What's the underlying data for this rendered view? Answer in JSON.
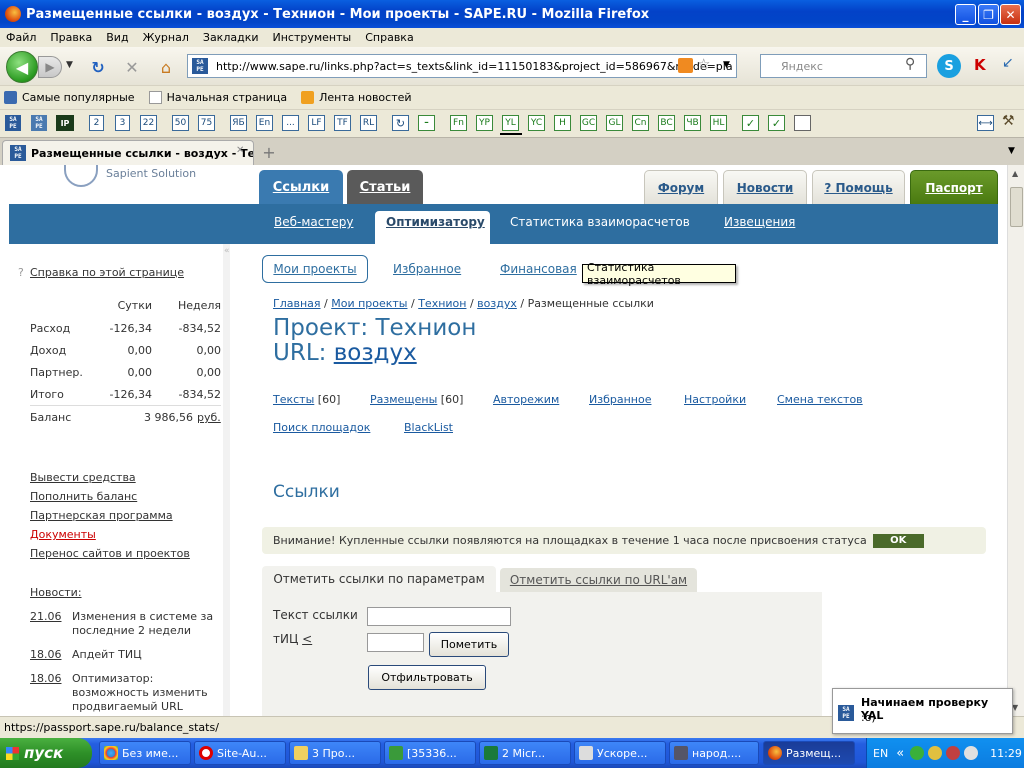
{
  "window": {
    "title": "Размещенные ссылки - воздух - Технион - Мои проекты - SAPE.RU - Mozilla Firefox",
    "minimize": "_",
    "maximize": "❐",
    "close": "✕"
  },
  "menu": [
    "Файл",
    "Правка",
    "Вид",
    "Журнал",
    "Закладки",
    "Инструменты",
    "Справка"
  ],
  "nav": {
    "url": "http://www.sape.ru/links.php?act=s_texts&link_id=11150183&project_id=586967&mode=pla",
    "search_placeholder": "Яндекс",
    "search_engine_logo": "Я"
  },
  "bookmarks": [
    "Самые популярные",
    "Начальная страница",
    "Лента новостей"
  ],
  "sape_toolbar": [
    "2",
    "3",
    "22",
    "50",
    "75",
    "ЯБ",
    "En",
    "...",
    "LF",
    "TF",
    "RL",
    "Fn",
    "YP",
    "YL",
    "YC",
    "H",
    "GC",
    "GL",
    "Cn",
    "BC",
    "ЧВ",
    "HL"
  ],
  "tab": {
    "label": "Размещенные ссылки - воздух - Те...",
    "new_tab": "+"
  },
  "site": {
    "brand": "Sapient Solution",
    "main_tabs": [
      "Ссылки",
      "Статьи"
    ],
    "top_tabs": [
      "Форум",
      "Новости",
      "? Помощь",
      "Паспорт"
    ],
    "subnav": [
      "Веб-мастеру",
      "Оптимизатору",
      "Статистика взаиморасчетов",
      "Извещения"
    ]
  },
  "sidebar": {
    "help": "Справка по этой странице",
    "head_day": "Сутки",
    "head_week": "Неделя",
    "rows": [
      {
        "label": "Расход",
        "day": "-126,34",
        "week": "-834,52"
      },
      {
        "label": "Доход",
        "day": "0,00",
        "week": "0,00"
      },
      {
        "label": "Партнер.",
        "day": "0,00",
        "week": "0,00"
      },
      {
        "label": "Итого",
        "day": "-126,34",
        "week": "-834,52"
      }
    ],
    "balance_label": "Баланс",
    "balance_value": "3 986,56",
    "balance_currency": "руб.",
    "links": [
      "Вывести средства",
      "Пополнить баланс",
      "Партнерская программа",
      "Документы",
      "Перенос сайтов и проектов"
    ],
    "news_title": "Новости:",
    "news": [
      {
        "date": "21.06",
        "text": "Изменения в системе за последние 2 недели"
      },
      {
        "date": "18.06",
        "text": "Апдейт ТИЦ"
      },
      {
        "date": "18.06",
        "text": "Оптимизатор: возможность изменить продвигаемый URL"
      }
    ]
  },
  "main": {
    "pill_tabs": [
      "Мои проекты",
      "Избранное",
      "Финансовая"
    ],
    "tooltip": "Статистика взаиморасчетов",
    "breadcrumb": [
      "Главная",
      "Мои проекты",
      "Технион",
      "воздух",
      "Размещенные ссылки"
    ],
    "project_label": "Проект:",
    "project_name": "Технион",
    "url_label": "URL:",
    "url_value": "воздух",
    "actions": [
      {
        "label": "Тексты",
        "count": "[60]"
      },
      {
        "label": "Размещены",
        "count": "[60]"
      },
      {
        "label": "Авторежим",
        "count": ""
      },
      {
        "label": "Избранное",
        "count": ""
      },
      {
        "label": "Настройки",
        "count": ""
      },
      {
        "label": "Смена текстов",
        "count": ""
      }
    ],
    "actions2": [
      "Поиск площадок",
      "BlackList"
    ],
    "section_title": "Ссылки",
    "notice": "Внимание! Купленные ссылки появляются на площадках в течение 1 часа после присвоения статуса",
    "notice_badge": "OK",
    "filter_tabs": [
      "Отметить ссылки по параметрам",
      "Отметить ссылки по URL'ам"
    ],
    "field_text_label": "Текст ссылки",
    "field_tic_label": "тИЦ",
    "field_tic_op": "<",
    "mark_button": "Пометить",
    "filter_button": "Отфильтровать"
  },
  "status": "https://passport.sape.ru/balance_stats/",
  "notification": {
    "title": "Начинаем проверку YAL",
    "body": ":o)"
  },
  "taskbar": {
    "start": "пуск",
    "tasks": [
      "Без име...",
      "Site-Au...",
      "3 Про...",
      "[35336...",
      "2 Micr...",
      "Ускоре...",
      "народ....",
      "Размещ..."
    ],
    "lang": "EN",
    "clock": "11:29"
  }
}
